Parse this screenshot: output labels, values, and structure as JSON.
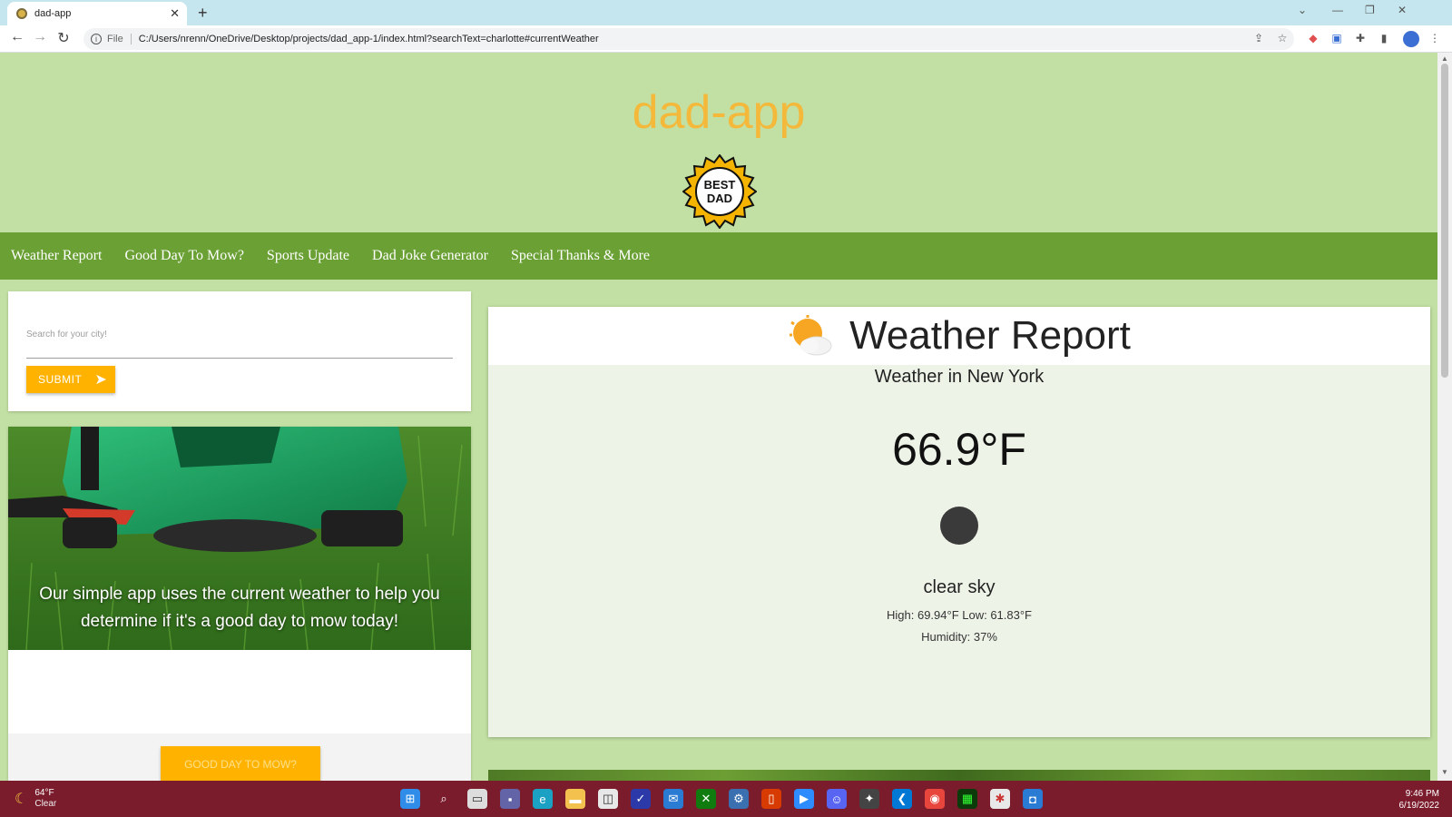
{
  "browser": {
    "tab_title": "dad-app",
    "tab_close": "✕",
    "new_tab": "+",
    "scheme_label": "File",
    "url": "C:/Users/nrenn/OneDrive/Desktop/projects/dad_app-1/index.html?searchText=charlotte#currentWeather"
  },
  "app": {
    "title": "dad-app",
    "badge_line1": "BEST",
    "badge_line2": "DAD"
  },
  "nav": {
    "items": [
      "Weather Report",
      "Good Day To Mow?",
      "Sports Update",
      "Dad Joke Generator",
      "Special Thanks & More"
    ]
  },
  "search": {
    "placeholder": "Search for your city!",
    "submit_label": "SUBMIT"
  },
  "mower": {
    "caption": "Our simple app uses the current weather to help you determine if it's a good day to mow today!",
    "button_label": "GOOD DAY TO MOW?"
  },
  "weather": {
    "heading": "Weather Report",
    "city": "Weather in New York",
    "temperature": "66.9°F",
    "description": "clear sky",
    "high_low": "High: 69.94°F Low: 61.83°F",
    "humidity": "Humidity: 37%"
  },
  "taskbar": {
    "weather_temp": "64°F",
    "weather_desc": "Clear",
    "time": "9:46 PM",
    "date": "6/19/2022"
  },
  "colors": {
    "page_bg": "#c2e0a3",
    "navbar": "#6aa034",
    "accent": "#ffb300",
    "title": "#f4b83a",
    "taskbar": "#7a1c2c"
  }
}
